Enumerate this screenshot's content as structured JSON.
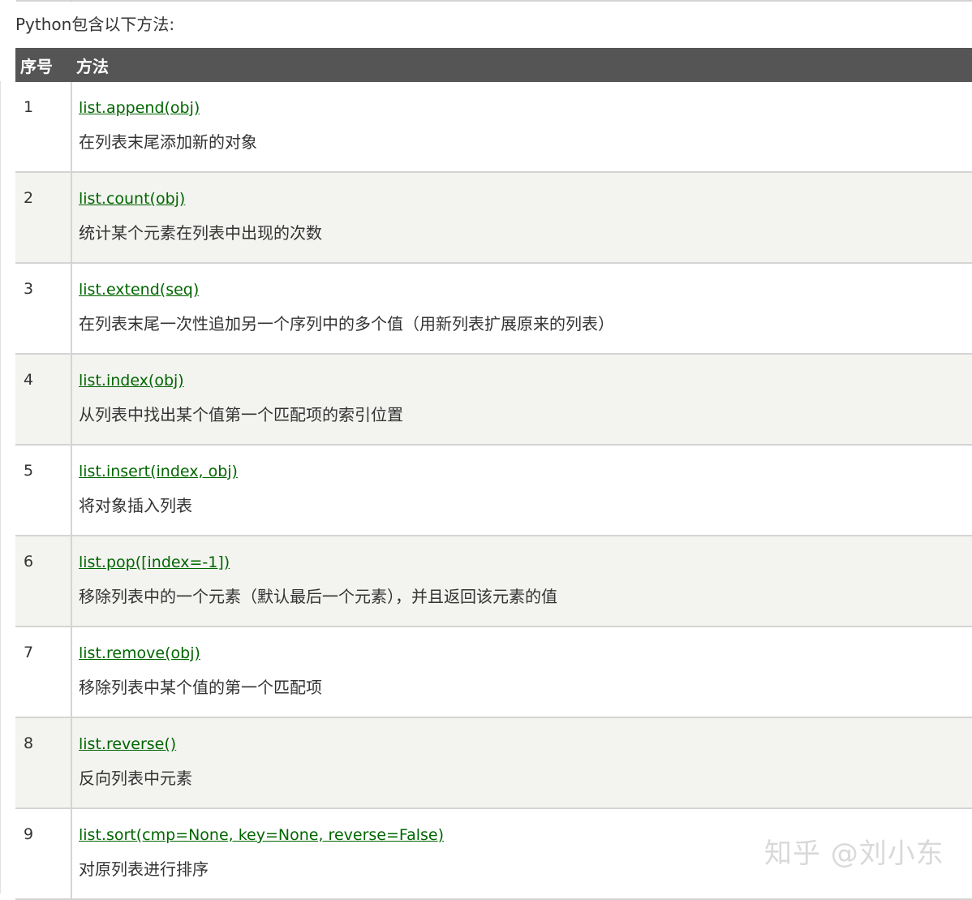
{
  "intro": "Python包含以下方法:",
  "table": {
    "headers": {
      "number": "序号",
      "method": "方法"
    },
    "rows": [
      {
        "number": "1",
        "method": "list.append(obj)",
        "description": "在列表末尾添加新的对象"
      },
      {
        "number": "2",
        "method": "list.count(obj)",
        "description": "统计某个元素在列表中出现的次数"
      },
      {
        "number": "3",
        "method": "list.extend(seq)",
        "description": "在列表末尾一次性追加另一个序列中的多个值（用新列表扩展原来的列表）"
      },
      {
        "number": "4",
        "method": "list.index(obj)",
        "description": "从列表中找出某个值第一个匹配项的索引位置"
      },
      {
        "number": "5",
        "method": "list.insert(index, obj)",
        "description": "将对象插入列表"
      },
      {
        "number": "6",
        "method": "list.pop([index=-1])",
        "description": "移除列表中的一个元素（默认最后一个元素），并且返回该元素的值"
      },
      {
        "number": "7",
        "method": "list.remove(obj)",
        "description": "移除列表中某个值的第一个匹配项"
      },
      {
        "number": "8",
        "method": "list.reverse()",
        "description": "反向列表中元素"
      },
      {
        "number": "9",
        "method": "list.sort(cmp=None, key=None, reverse=False)",
        "description": "对原列表进行排序"
      }
    ]
  },
  "watermark": "知乎 @刘小东",
  "colors": {
    "header_bg": "#555555",
    "link": "#006600",
    "row_alt": "#f3f3f0"
  }
}
